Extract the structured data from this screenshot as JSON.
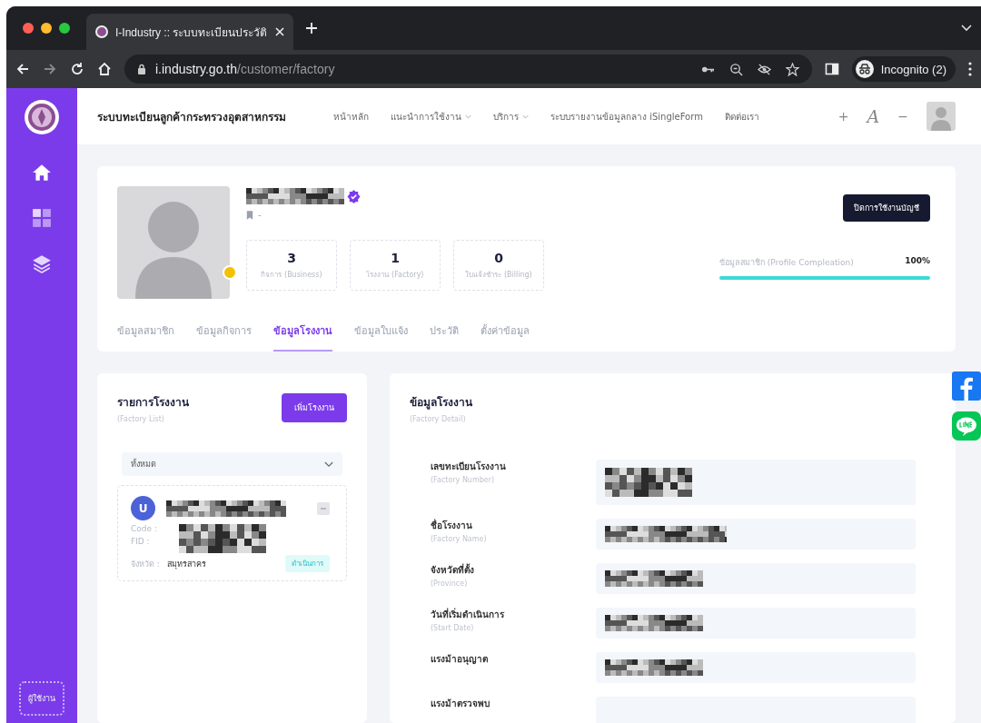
{
  "browser": {
    "tab_title": "I-Industry :: ระบบทะเบียนประวัติ",
    "url_host": "i.industry.go.th",
    "url_path": "/customer/factory",
    "profile_label": "Incognito (2)"
  },
  "sidebar": {
    "items": [
      {
        "kind": "home",
        "selected": true
      },
      {
        "kind": "grid",
        "selected": false
      },
      {
        "kind": "layers",
        "selected": false
      }
    ],
    "user_label": "ผู้ใช้งาน"
  },
  "header": {
    "brand": "ระบบทะเบียนลูกค้ากระทรวงอุตสาหกรรม",
    "nav": [
      {
        "label": "หน้าหลัก",
        "dropdown": false
      },
      {
        "label": "แนะนำการใช้งาน",
        "dropdown": true
      },
      {
        "label": "บริการ",
        "dropdown": true
      },
      {
        "label": "ระบบรายงานข้อมูลกลาง iSingleForm",
        "dropdown": false
      },
      {
        "label": "ติดต่อเรา",
        "dropdown": false
      }
    ],
    "font_controls": [
      "+",
      "A",
      "−"
    ]
  },
  "profile": {
    "name_redacted": true,
    "verified": true,
    "online": true,
    "bookmark_text": "-",
    "stats": [
      {
        "value": "3",
        "label": "กิจการ (Business)"
      },
      {
        "value": "1",
        "label": "โรงงาน (Factory)"
      },
      {
        "value": "0",
        "label": "ใบแจ้งชำระ (Billing)"
      }
    ],
    "deactivate_button": "ปิดการใช้งานบัญชี",
    "completion": {
      "label": "ข้อมูลสมาชิก (Profile Compleation)",
      "reading": "100%",
      "level": 1.0
    },
    "tabs": [
      {
        "label": "ข้อมูลสมาชิก",
        "selected": false
      },
      {
        "label": "ข้อมูลกิจการ",
        "selected": false
      },
      {
        "label": "ข้อมูลโรงงาน",
        "selected": true
      },
      {
        "label": "ข้อมูลใบแจ้ง",
        "selected": false
      },
      {
        "label": "ประวัติ",
        "selected": false
      },
      {
        "label": "ตั้งค่าข้อมูล",
        "selected": false
      }
    ]
  },
  "factory_list": {
    "title": "รายการโรงงาน",
    "subtitle": "(Factory List)",
    "add_button": "เพิ่มโรงงาน",
    "filter": {
      "value": "ทั้งหมด"
    },
    "items": [
      {
        "avatar": "U",
        "name_redacted": true,
        "code_label": "Code :",
        "fid_label": "FID :",
        "codes_redacted": true,
        "province_label": "จังหวัด :",
        "province": "สมุทรสาคร",
        "status": "ดำเนินการ"
      }
    ]
  },
  "factory_detail": {
    "title": "ข้อมูลโรงงาน",
    "subtitle": "(Factory Detail)",
    "fields": [
      {
        "label": "เลขทะเบียนโรงงาน",
        "sublabel": "(Factory Number)",
        "redacted": true,
        "kind": "tall"
      },
      {
        "label": "ชื่อโรงงาน",
        "sublabel": "(Factory Name)",
        "redacted": true,
        "kind": "wide"
      },
      {
        "label": "จังหวัดที่ตั้ง",
        "sublabel": "(Province)",
        "redacted": true,
        "kind": "normal"
      },
      {
        "label": "วันที่เริ่มดำเนินการ",
        "sublabel": "(Start Date)",
        "redacted": true,
        "kind": "normal"
      },
      {
        "label": "แรงม้าอนุญาต",
        "redacted": true,
        "kind": "normal"
      },
      {
        "label": "แรงม้าตรวจพบ",
        "redacted": false,
        "kind": "normal"
      }
    ]
  },
  "social": [
    {
      "kind": "facebook"
    },
    {
      "kind": "line"
    }
  ]
}
